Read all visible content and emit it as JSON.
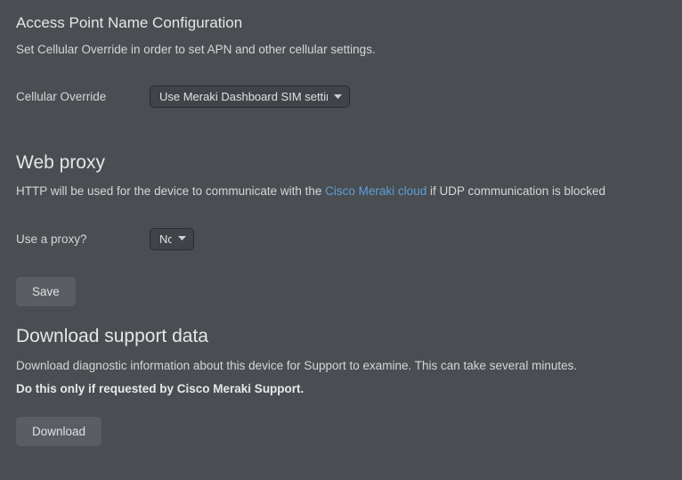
{
  "apn": {
    "title": "Access Point Name Configuration",
    "description": "Set Cellular Override in order to set APN and other cellular settings.",
    "field_label": "Cellular Override",
    "select_value": "Use Meraki Dashboard SIM settings"
  },
  "webproxy": {
    "title": "Web proxy",
    "desc_before": "HTTP will be used for the device to communicate with the ",
    "desc_link": "Cisco Meraki cloud",
    "desc_after": " if UDP communication is blocked",
    "field_label": "Use a proxy?",
    "select_value": "No",
    "save_label": "Save"
  },
  "download": {
    "title": "Download support data",
    "description": "Download diagnostic information about this device for Support to examine. This can take several minutes.",
    "warning": "Do this only if requested by Cisco Meraki Support.",
    "button_label": "Download"
  }
}
